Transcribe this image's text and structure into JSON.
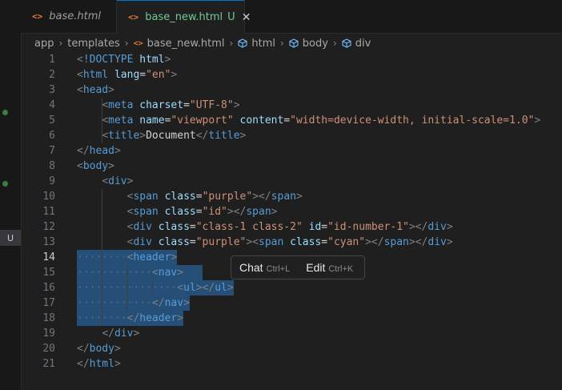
{
  "activity": {
    "badge": "U"
  },
  "tabs": [
    {
      "icon": "<>",
      "label": "base.html",
      "status": "",
      "active": false
    },
    {
      "icon": "<>",
      "label": "base_new.html",
      "status": "U",
      "active": true,
      "close": "✕"
    }
  ],
  "breadcrumb": {
    "items": [
      "app",
      "templates",
      "base_new.html",
      "html",
      "body",
      "div"
    ],
    "file_icon": "<>"
  },
  "editor": {
    "line_numbers": [
      "1",
      "2",
      "3",
      "4",
      "5",
      "6",
      "7",
      "8",
      "9",
      "10",
      "11",
      "12",
      "13",
      "14",
      "15",
      "16",
      "17",
      "18",
      "19",
      "20",
      "21"
    ],
    "current_line": 14,
    "lines": [
      [
        [
          "tg",
          "<"
        ],
        [
          "tn",
          "!DOCTYPE"
        ],
        [
          "tx",
          " "
        ],
        [
          "at",
          "html"
        ],
        [
          "tg",
          ">"
        ]
      ],
      [
        [
          "tg",
          "<"
        ],
        [
          "tn",
          "html"
        ],
        [
          "tx",
          " "
        ],
        [
          "at",
          "lang"
        ],
        [
          "tx",
          "="
        ],
        [
          "av",
          "\"en\""
        ],
        [
          "tg",
          ">"
        ]
      ],
      [
        [
          "tg",
          "<"
        ],
        [
          "tn",
          "head"
        ],
        [
          "tg",
          ">"
        ]
      ],
      [
        [
          "tx",
          "    "
        ],
        [
          "tg",
          "<"
        ],
        [
          "tn",
          "meta"
        ],
        [
          "tx",
          " "
        ],
        [
          "at",
          "charset"
        ],
        [
          "tx",
          "="
        ],
        [
          "av",
          "\"UTF-8\""
        ],
        [
          "tg",
          ">"
        ]
      ],
      [
        [
          "tx",
          "    "
        ],
        [
          "tg",
          "<"
        ],
        [
          "tn",
          "meta"
        ],
        [
          "tx",
          " "
        ],
        [
          "at",
          "name"
        ],
        [
          "tx",
          "="
        ],
        [
          "av",
          "\"viewport\""
        ],
        [
          "tx",
          " "
        ],
        [
          "at",
          "content"
        ],
        [
          "tx",
          "="
        ],
        [
          "av",
          "\"width=device-width, initial-scale=1.0\""
        ],
        [
          "tg",
          ">"
        ]
      ],
      [
        [
          "tx",
          "    "
        ],
        [
          "tg",
          "<"
        ],
        [
          "tn",
          "title"
        ],
        [
          "tg",
          ">"
        ],
        [
          "tx",
          "Document"
        ],
        [
          "tg",
          "</"
        ],
        [
          "tn",
          "title"
        ],
        [
          "tg",
          ">"
        ]
      ],
      [
        [
          "tg",
          "</"
        ],
        [
          "tn",
          "head"
        ],
        [
          "tg",
          ">"
        ]
      ],
      [
        [
          "tg",
          "<"
        ],
        [
          "tn",
          "body"
        ],
        [
          "tg",
          ">"
        ]
      ],
      [
        [
          "tx",
          "    "
        ],
        [
          "tg",
          "<"
        ],
        [
          "tn",
          "div"
        ],
        [
          "tg",
          ">"
        ]
      ],
      [
        [
          "tx",
          "        "
        ],
        [
          "tg",
          "<"
        ],
        [
          "tn",
          "span"
        ],
        [
          "tx",
          " "
        ],
        [
          "at",
          "class"
        ],
        [
          "tx",
          "="
        ],
        [
          "av",
          "\"purple\""
        ],
        [
          "tg",
          "></"
        ],
        [
          "tn",
          "span"
        ],
        [
          "tg",
          ">"
        ]
      ],
      [
        [
          "tx",
          "        "
        ],
        [
          "tg",
          "<"
        ],
        [
          "tn",
          "span"
        ],
        [
          "tx",
          " "
        ],
        [
          "at",
          "class"
        ],
        [
          "tx",
          "="
        ],
        [
          "av",
          "\"id\""
        ],
        [
          "tg",
          "></"
        ],
        [
          "tn",
          "span"
        ],
        [
          "tg",
          ">"
        ]
      ],
      [
        [
          "tx",
          "        "
        ],
        [
          "tg",
          "<"
        ],
        [
          "tn",
          "div"
        ],
        [
          "tx",
          " "
        ],
        [
          "at",
          "class"
        ],
        [
          "tx",
          "="
        ],
        [
          "av",
          "\"class-1 class-2\""
        ],
        [
          "tx",
          " "
        ],
        [
          "at",
          "id"
        ],
        [
          "tx",
          "="
        ],
        [
          "av",
          "\"id-number-1\""
        ],
        [
          "tg",
          "></"
        ],
        [
          "tn",
          "div"
        ],
        [
          "tg",
          ">"
        ]
      ],
      [
        [
          "tx",
          "        "
        ],
        [
          "tg",
          "<"
        ],
        [
          "tn",
          "div"
        ],
        [
          "tx",
          " "
        ],
        [
          "at",
          "class"
        ],
        [
          "tx",
          "="
        ],
        [
          "av",
          "\"purple\""
        ],
        [
          "tg",
          "><"
        ],
        [
          "tn",
          "span"
        ],
        [
          "tx",
          " "
        ],
        [
          "at",
          "class"
        ],
        [
          "tx",
          "="
        ],
        [
          "av",
          "\"cyan\""
        ],
        [
          "tg",
          "></"
        ],
        [
          "tn",
          "span"
        ],
        [
          "tg",
          "></"
        ],
        [
          "tn",
          "div"
        ],
        [
          "tg",
          ">"
        ]
      ],
      [
        [
          "ws",
          "········"
        ],
        [
          "tg",
          "<"
        ],
        [
          "tn",
          "header"
        ],
        [
          "tg",
          ">"
        ]
      ],
      [
        [
          "ws",
          "············"
        ],
        [
          "tg",
          "<"
        ],
        [
          "tn",
          "nav"
        ],
        [
          "tg",
          ">"
        ]
      ],
      [
        [
          "ws",
          "················"
        ],
        [
          "tg",
          "<"
        ],
        [
          "tn",
          "ul"
        ],
        [
          "tg",
          "></"
        ],
        [
          "tn",
          "ul"
        ],
        [
          "tg",
          ">"
        ]
      ],
      [
        [
          "ws",
          "············"
        ],
        [
          "tg",
          "</"
        ],
        [
          "tn",
          "nav"
        ],
        [
          "tg",
          ">"
        ]
      ],
      [
        [
          "ws",
          "········"
        ],
        [
          "tg",
          "</"
        ],
        [
          "tn",
          "header"
        ],
        [
          "tg",
          ">"
        ]
      ],
      [
        [
          "tx",
          "    "
        ],
        [
          "tg",
          "</"
        ],
        [
          "tn",
          "div"
        ],
        [
          "tg",
          ">"
        ]
      ],
      [
        [
          "tg",
          "</"
        ],
        [
          "tn",
          "body"
        ],
        [
          "tg",
          ">"
        ]
      ],
      [
        [
          "tg",
          "</"
        ],
        [
          "tn",
          "html"
        ],
        [
          "tg",
          ">"
        ]
      ]
    ]
  },
  "hint": {
    "chat_label": "Chat",
    "chat_shortcut": "Ctrl+L",
    "edit_label": "Edit",
    "edit_shortcut": "Ctrl+K"
  },
  "colors": {
    "background": "#1f1f1f",
    "selection": "#264f78",
    "tag": "#569cd6",
    "attribute": "#9cdcfe",
    "string": "#ce9178",
    "untracked": "#73c991",
    "accent": "#0078d4"
  }
}
